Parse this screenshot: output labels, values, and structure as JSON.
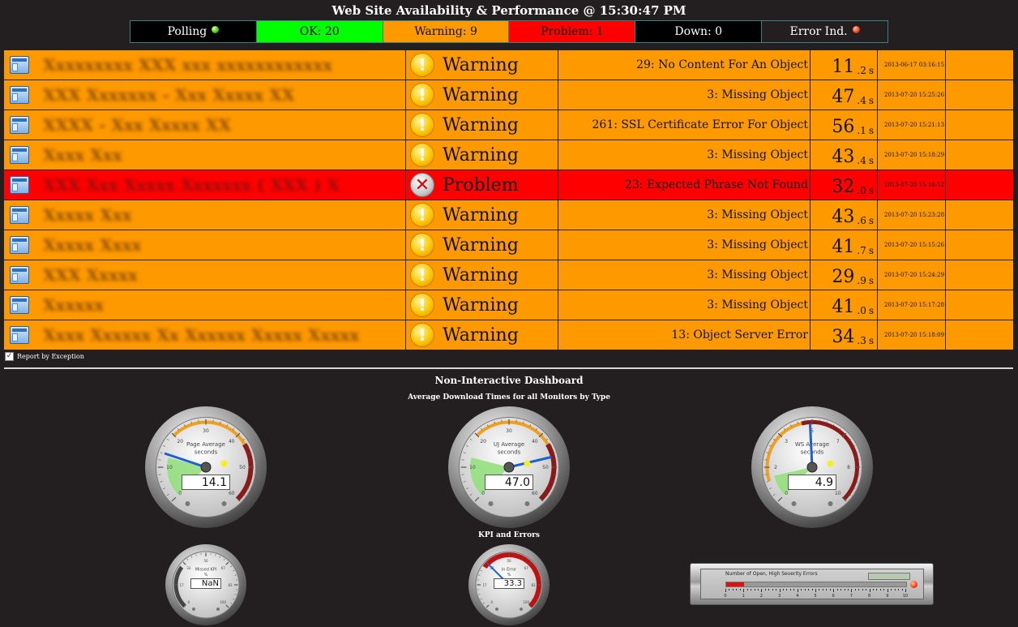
{
  "title": "Web Site Availability & Performance @ 15:30:47 PM",
  "statusbar": [
    {
      "label": "Polling",
      "bg": "#000000",
      "fg": "#ffffff",
      "indicator": "green"
    },
    {
      "label": "OK: 20",
      "bg": "#00ff00",
      "fg": "#000000",
      "indicator": ""
    },
    {
      "label": "Warning: 9",
      "bg": "#ff9900",
      "fg": "#111111",
      "indicator": ""
    },
    {
      "label": "Problem: 1",
      "bg": "#ff0000",
      "fg": "#111111",
      "indicator": ""
    },
    {
      "label": "Down: 0",
      "bg": "#000000",
      "fg": "#ffffff",
      "indicator": ""
    },
    {
      "label": "Error Ind.",
      "bg": "#231f20",
      "fg": "#ffffff",
      "indicator": "red"
    }
  ],
  "monitors": [
    {
      "name": "",
      "status": "Warning",
      "detail": "29: No Content For An Object",
      "time_int": "11",
      "time_dec": ".2",
      "unit": "s",
      "date": "2013-06-17 03:16:15"
    },
    {
      "name": "",
      "status": "Warning",
      "detail": "3: Missing Object",
      "time_int": "47",
      "time_dec": ".4",
      "unit": "s",
      "date": "2013-07-20 15:25:26"
    },
    {
      "name": "",
      "status": "Warning",
      "detail": "261: SSL Certificate Error For Object",
      "time_int": "56",
      "time_dec": ".1",
      "unit": "s",
      "date": "2013-07-20 15:21:13"
    },
    {
      "name": "",
      "status": "Warning",
      "detail": "3: Missing Object",
      "time_int": "43",
      "time_dec": ".4",
      "unit": "s",
      "date": "2013-07-20 15:18:29"
    },
    {
      "name": "",
      "status": "Problem",
      "detail": "23: Expected Phrase Not Found",
      "time_int": "32",
      "time_dec": ".0",
      "unit": "s",
      "date": "2013-07-20 15:16:52"
    },
    {
      "name": "",
      "status": "Warning",
      "detail": "3: Missing Object",
      "time_int": "43",
      "time_dec": ".6",
      "unit": "s",
      "date": "2013-07-20 15:23:28"
    },
    {
      "name": "",
      "status": "Warning",
      "detail": "3: Missing Object",
      "time_int": "41",
      "time_dec": ".7",
      "unit": "s",
      "date": "2013-07-20 15:15:26"
    },
    {
      "name": "",
      "status": "Warning",
      "detail": "3: Missing Object",
      "time_int": "29",
      "time_dec": ".9",
      "unit": "s",
      "date": "2013-07-20 15:24:29"
    },
    {
      "name": "",
      "status": "Warning",
      "detail": "3: Missing Object",
      "time_int": "41",
      "time_dec": ".0",
      "unit": "s",
      "date": "2013-07-20 15:17:28"
    },
    {
      "name": "",
      "status": "Warning",
      "detail": "13: Object Server Error",
      "time_int": "34",
      "time_dec": ".3",
      "unit": "s",
      "date": "2013-07-20 15:18:09"
    }
  ],
  "report_by_exception": {
    "label": "Report by Exception",
    "checked": true
  },
  "dashboard": {
    "title": "Non-Interactive Dashboard",
    "subtitle": "Average Download Times for all Monitors by Type",
    "kpi_title": "KPI and Errors"
  },
  "gauges": {
    "page": {
      "label": "Page Average",
      "unit": "seconds",
      "value": 14.1,
      "display": "14.1",
      "max": 60
    },
    "uj": {
      "label": "UJ Average",
      "unit": "seconds",
      "value": 47.0,
      "display": "47.0",
      "max": 60
    },
    "ws": {
      "label": "WS Average",
      "unit": "seconds",
      "value": 4.9,
      "display": "4.9",
      "max": 10
    },
    "kpi": {
      "label": "Missed KPI",
      "unit": "%",
      "value": null,
      "display": "NaN",
      "max": 100
    },
    "err": {
      "label": "In Error",
      "unit": "%",
      "value": 33.3,
      "display": "33.3",
      "max": 100
    }
  },
  "hbar": {
    "label": "Number of Open, High Severity Errors",
    "value": 1,
    "max": 10,
    "ticks": [
      "0",
      "1",
      "2",
      "3",
      "4",
      "5",
      "6",
      "7",
      "8",
      "9",
      "10"
    ]
  },
  "colors": {
    "warning": "#ff9900",
    "problem": "#ff0000",
    "ok": "#00ff00",
    "background": "#231f20"
  }
}
